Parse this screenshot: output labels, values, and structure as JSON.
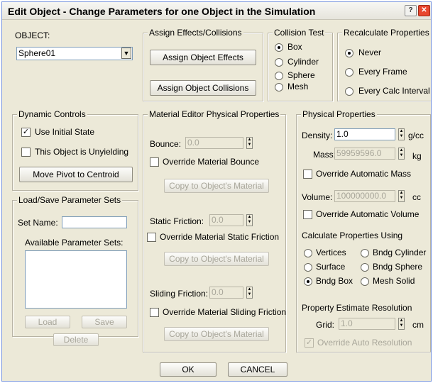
{
  "window": {
    "title": "Edit Object - Change Parameters for one Object in the Simulation",
    "help_label": "?",
    "close_label": "✕"
  },
  "object": {
    "label": "OBJECT:",
    "selected": "Sphere01",
    "dropdown_glyph": "▼"
  },
  "assign": {
    "title": "Assign Effects/Collisions",
    "effects_button": "Assign Object Effects",
    "collisions_button": "Assign Object Collisions"
  },
  "collision_test": {
    "title": "Collision Test",
    "options": [
      "Box",
      "Cylinder",
      "Sphere",
      "Mesh"
    ],
    "selected": "Box"
  },
  "recalculate": {
    "title": "Recalculate Properties",
    "options": [
      "Never",
      "Every Frame",
      "Every Calc Interval"
    ],
    "selected": "Never"
  },
  "dynamic_controls": {
    "title": "Dynamic Controls",
    "use_initial_state": "Use Initial State",
    "use_initial_state_checked": true,
    "unyielding": "This Object is Unyielding",
    "unyielding_checked": false,
    "move_pivot_button": "Move Pivot to Centroid"
  },
  "load_save": {
    "title": "Load/Save Parameter Sets",
    "set_name_label": "Set Name:",
    "set_name_value": "",
    "available_label": "Available Parameter Sets:",
    "load_button": "Load",
    "save_button": "Save",
    "delete_button": "Delete"
  },
  "material_editor": {
    "title": "Material Editor Physical Properties",
    "bounce_label": "Bounce:",
    "bounce_value": "0.0",
    "override_bounce": "Override Material Bounce",
    "static_label": "Static Friction:",
    "static_value": "0.0",
    "override_static": "Override Material Static Friction",
    "sliding_label": "Sliding Friction:",
    "sliding_value": "0.0",
    "override_sliding": "Override Material Sliding Friction",
    "copy_button": "Copy to Object's Material"
  },
  "physical": {
    "title": "Physical Properties",
    "density_label": "Density:",
    "density_value": "1.0",
    "density_unit": "g/cc",
    "mass_label": "Mass:",
    "mass_value": "59959596.0",
    "mass_unit": "kg",
    "override_mass": "Override Automatic Mass",
    "volume_label": "Volume:",
    "volume_value": "100000000.0",
    "volume_unit": "cc",
    "override_volume": "Override Automatic Volume",
    "calc_label": "Calculate Properties Using",
    "calc_options": [
      "Vertices",
      "Bndg Cylinder",
      "Surface",
      "Bndg Sphere",
      "Bndg Box",
      "Mesh Solid"
    ],
    "calc_selected": "Bndg Box",
    "resolution_label": "Property Estimate Resolution",
    "grid_label": "Grid:",
    "grid_value": "1.0",
    "grid_unit": "cm",
    "override_auto_resolution": "Override Auto Resolution",
    "override_auto_resolution_checked": true
  },
  "footer": {
    "ok_button": "OK",
    "cancel_button": "CANCEL"
  },
  "glyphs": {
    "check": "✓",
    "spin_up": "▲",
    "spin_down": "▼"
  }
}
